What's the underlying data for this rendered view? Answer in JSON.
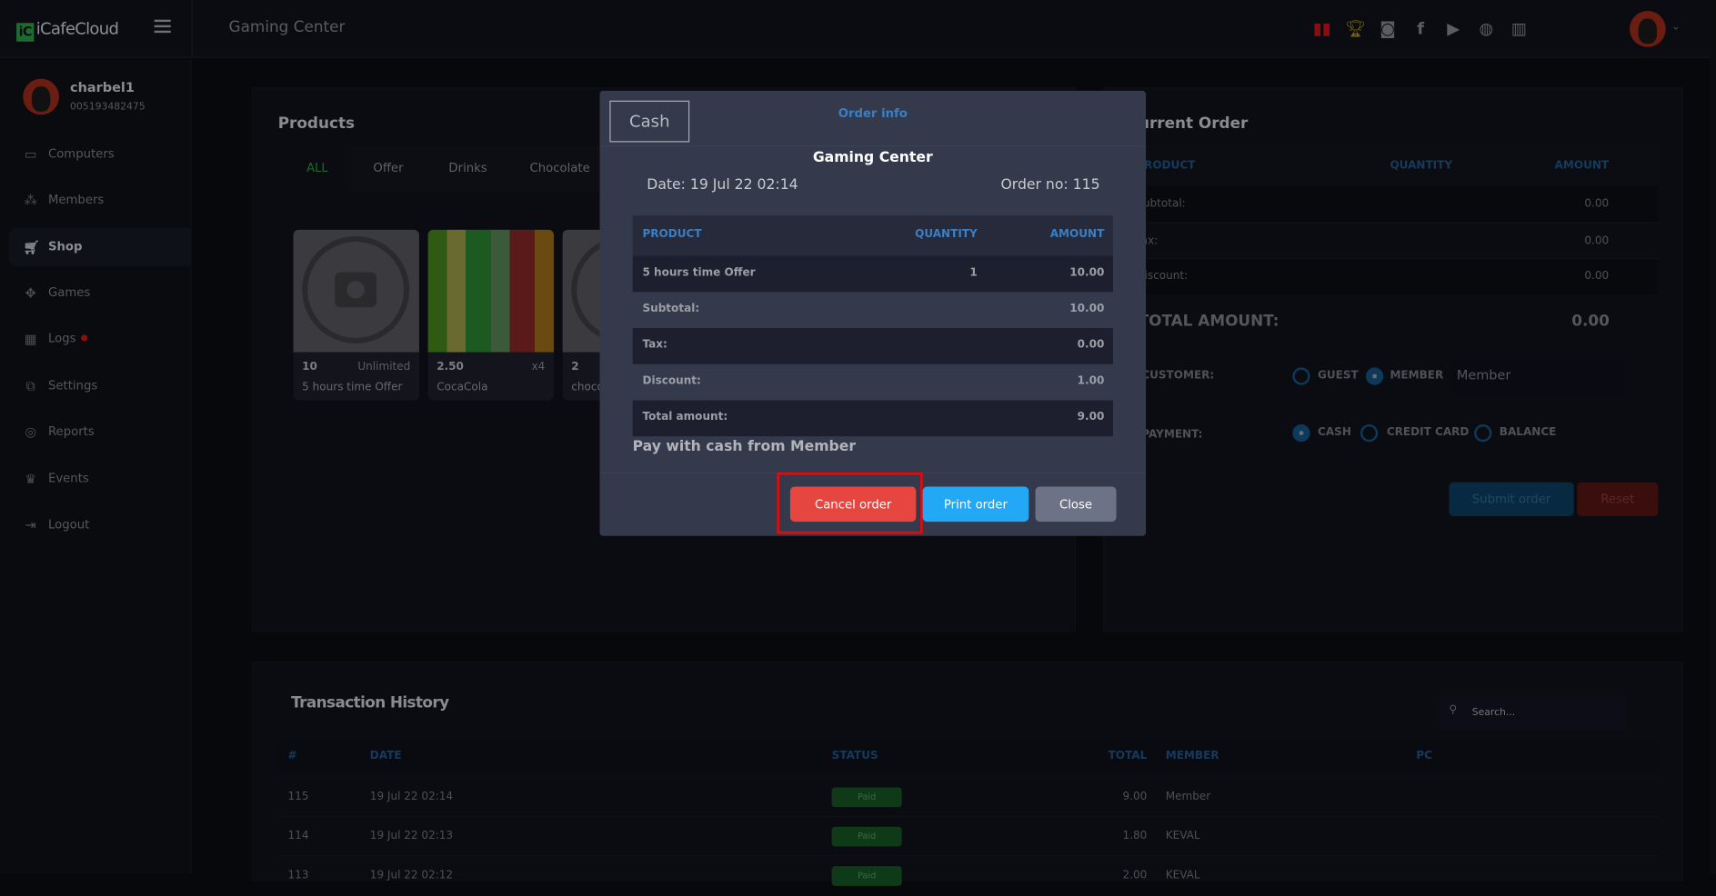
{
  "app": {
    "logo": "iCafeCloud",
    "logo_mark": "iC",
    "title": "Gaming Center"
  },
  "topbar_icons": [
    "ranking-icon",
    "trophy-icon",
    "discord-icon",
    "facebook-icon",
    "youtube-icon",
    "globe-icon",
    "book-icon"
  ],
  "user": {
    "name": "charbel1",
    "id": "005193482475"
  },
  "sidebar": {
    "items": [
      {
        "label": "Computers",
        "icon": "monitor-icon"
      },
      {
        "label": "Members",
        "icon": "users-icon"
      },
      {
        "label": "Shop",
        "icon": "cart-icon",
        "active": true
      },
      {
        "label": "Games",
        "icon": "gamepad-icon"
      },
      {
        "label": "Logs",
        "icon": "calendar-icon",
        "notification": true
      },
      {
        "label": "Settings",
        "icon": "settings-icon"
      },
      {
        "label": "Reports",
        "icon": "reports-icon"
      },
      {
        "label": "Events",
        "icon": "crown-icon"
      },
      {
        "label": "Logout",
        "icon": "logout-icon"
      }
    ]
  },
  "products": {
    "title": "Products",
    "tabs": [
      "ALL",
      "Offer",
      "Drinks",
      "Chocolate"
    ],
    "items": [
      {
        "price": "10",
        "stock": "Unlimited",
        "name": "5 hours time Offer"
      },
      {
        "price": "2.50",
        "stock": "x4",
        "name": "CocaCola"
      },
      {
        "price": "2",
        "stock": "",
        "name": "chocolate"
      }
    ]
  },
  "current_order": {
    "title": "Current Order",
    "headers": [
      "PRODUCT",
      "QUANTITY",
      "AMOUNT"
    ],
    "rows": [
      {
        "label": "Subtotal:",
        "value": "0.00"
      },
      {
        "label": "Tax:",
        "value": "0.00"
      },
      {
        "label": "Discount:",
        "value": "0.00"
      }
    ],
    "total_label": "TOTAL AMOUNT:",
    "total_value": "0.00",
    "customer_label": "CUSTOMER:",
    "customer_options": [
      "GUEST",
      "MEMBER"
    ],
    "customer_selected": "MEMBER",
    "member_value": "Member",
    "payment_label": "PAYMENT:",
    "payment_options": [
      "CASH",
      "CREDIT CARD",
      "BALANCE"
    ],
    "payment_selected": "CASH",
    "submit": "Submit order",
    "reset": "Reset"
  },
  "transactions": {
    "title": "Transaction History",
    "search_placeholder": "Search...",
    "headers": [
      "#",
      "DATE",
      "STATUS",
      "TOTAL",
      "MEMBER",
      "PC"
    ],
    "rows": [
      {
        "id": "115",
        "date": "19 Jul 22 02:14",
        "status": "Paid",
        "total": "9.00",
        "member": "Member",
        "pc": ""
      },
      {
        "id": "114",
        "date": "19 Jul 22 02:13",
        "status": "Paid",
        "total": "1.80",
        "member": "KEVAL",
        "pc": ""
      },
      {
        "id": "113",
        "date": "19 Jul 22 02:12",
        "status": "Paid",
        "total": "2.00",
        "member": "KEVAL",
        "pc": ""
      }
    ]
  },
  "modal": {
    "badge": "Cash",
    "title": "Order info",
    "shop": "Gaming Center",
    "date": "Date: 19 Jul 22 02:14",
    "order_no": "Order no: 115",
    "headers": [
      "PRODUCT",
      "QUANTITY",
      "AMOUNT"
    ],
    "items": [
      {
        "product": "5 hours time Offer",
        "quantity": "1",
        "amount": "10.00"
      }
    ],
    "summary": [
      {
        "label": "Subtotal:",
        "value": "10.00"
      },
      {
        "label": "Tax:",
        "value": "0.00"
      },
      {
        "label": "Discount:",
        "value": "1.00"
      },
      {
        "label": "Total amount:",
        "value": "9.00"
      }
    ],
    "pay_note": "Pay with cash from Member",
    "cancel": "Cancel order",
    "print": "Print order",
    "close": "Close"
  },
  "colors": {
    "accent": "#3a7fc4",
    "cancel": "#e5463f",
    "print": "#22a8f5",
    "close": "#6c7386",
    "highlight": "#ff0000"
  }
}
